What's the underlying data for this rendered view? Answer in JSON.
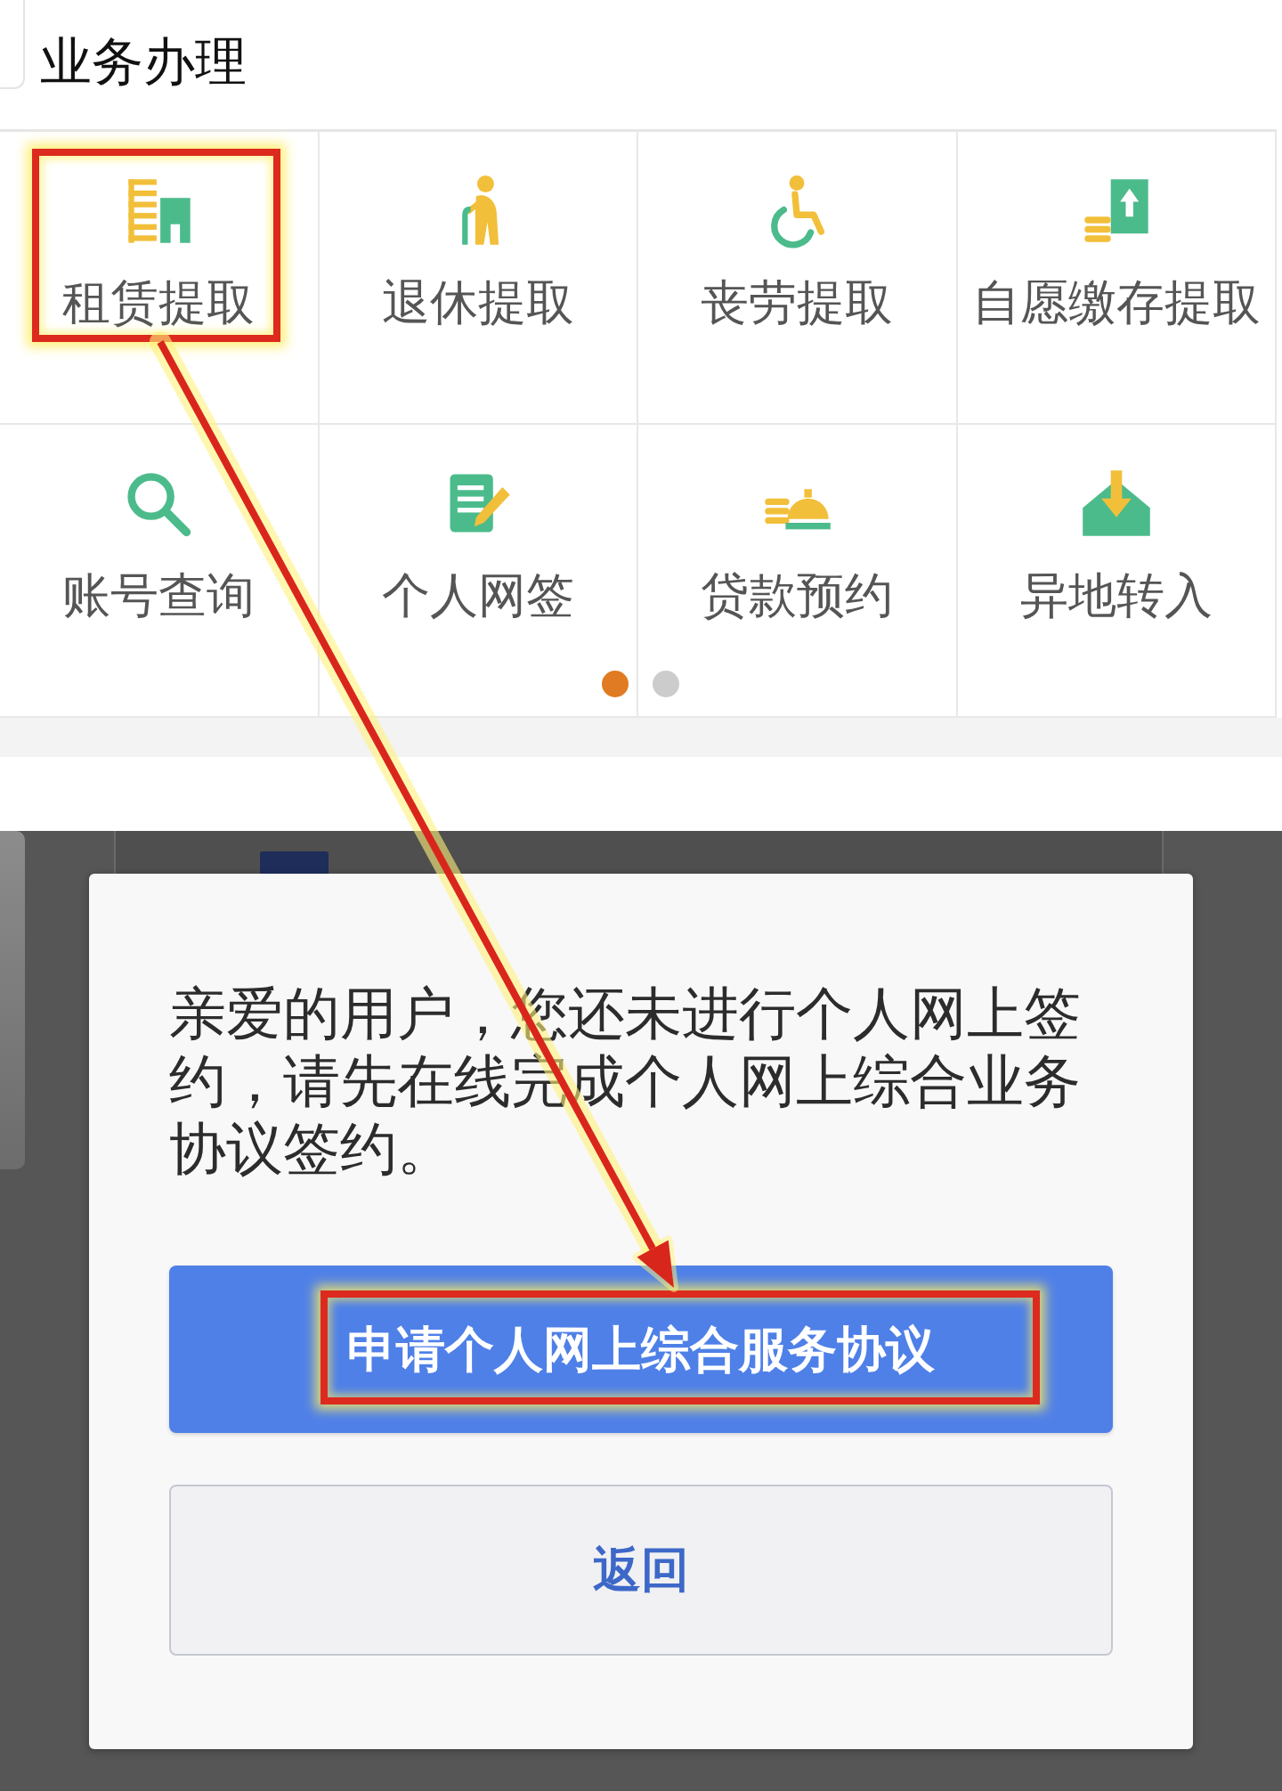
{
  "header": {
    "title": "业务办理"
  },
  "grid": {
    "items": [
      {
        "label": "租赁提取",
        "kind": "lease",
        "highlighted": true
      },
      {
        "label": "退休提取",
        "kind": "retire",
        "highlighted": false
      },
      {
        "label": "丧劳提取",
        "kind": "wheelchair",
        "highlighted": false
      },
      {
        "label": "自愿缴存提取",
        "kind": "deposit",
        "highlighted": false
      },
      {
        "label": "账号查询",
        "kind": "search",
        "highlighted": false
      },
      {
        "label": "个人网签",
        "kind": "sign",
        "highlighted": false
      },
      {
        "label": "贷款预约",
        "kind": "loan",
        "highlighted": false
      },
      {
        "label": "异地转入",
        "kind": "transfer",
        "highlighted": false
      }
    ],
    "pager": [
      {
        "selected": true
      },
      {
        "selected": false
      }
    ]
  },
  "dialog": {
    "message": "亲爱的用户，您还未进行个人网上签约，请先在线完成个人网上综合业务协议签约。",
    "buttons": [
      {
        "label": "申请个人网上综合服务协议",
        "kind": "primary",
        "highlighted": true
      },
      {
        "label": "返回",
        "kind": "secondary",
        "highlighted": false
      }
    ]
  }
}
